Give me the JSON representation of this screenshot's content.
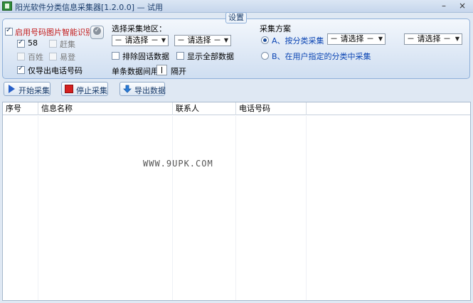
{
  "window": {
    "title": "阳光软件分类信息采集器[1.2.0.0] — 试用",
    "minimize": "–",
    "close": "×"
  },
  "settings": {
    "group_title": "设置",
    "enable_ocr": "启用号码图片智能识别",
    "sources": {
      "s58": "58",
      "ganji": "赶集",
      "baixing": "百姓",
      "yiyuan": "易登"
    },
    "export_phone_only": "仅导出电话号码",
    "region_label": "选择采集地区：",
    "select_placeholder": "－ 请选择 －",
    "exclude_landline": "排除固话数据",
    "show_all": "显示全部数据",
    "interval_label": "单条数据间用",
    "interval_suffix": "隔开",
    "scheme_label": "采集方案",
    "scheme_a": "A、按分类采集",
    "scheme_b": "B、在用户指定的分类中采集"
  },
  "toolbar": {
    "start": "开始采集",
    "stop": "停止采集",
    "export": "导出数据"
  },
  "table": {
    "columns": [
      "序号",
      "信息名称",
      "联系人",
      "电话号码"
    ],
    "rows": []
  },
  "watermark": "WWW.9UPK.COM",
  "colors": {
    "accent": "#0a44b3",
    "warning": "#c21a1a",
    "panel_border": "#8fb0d9"
  }
}
